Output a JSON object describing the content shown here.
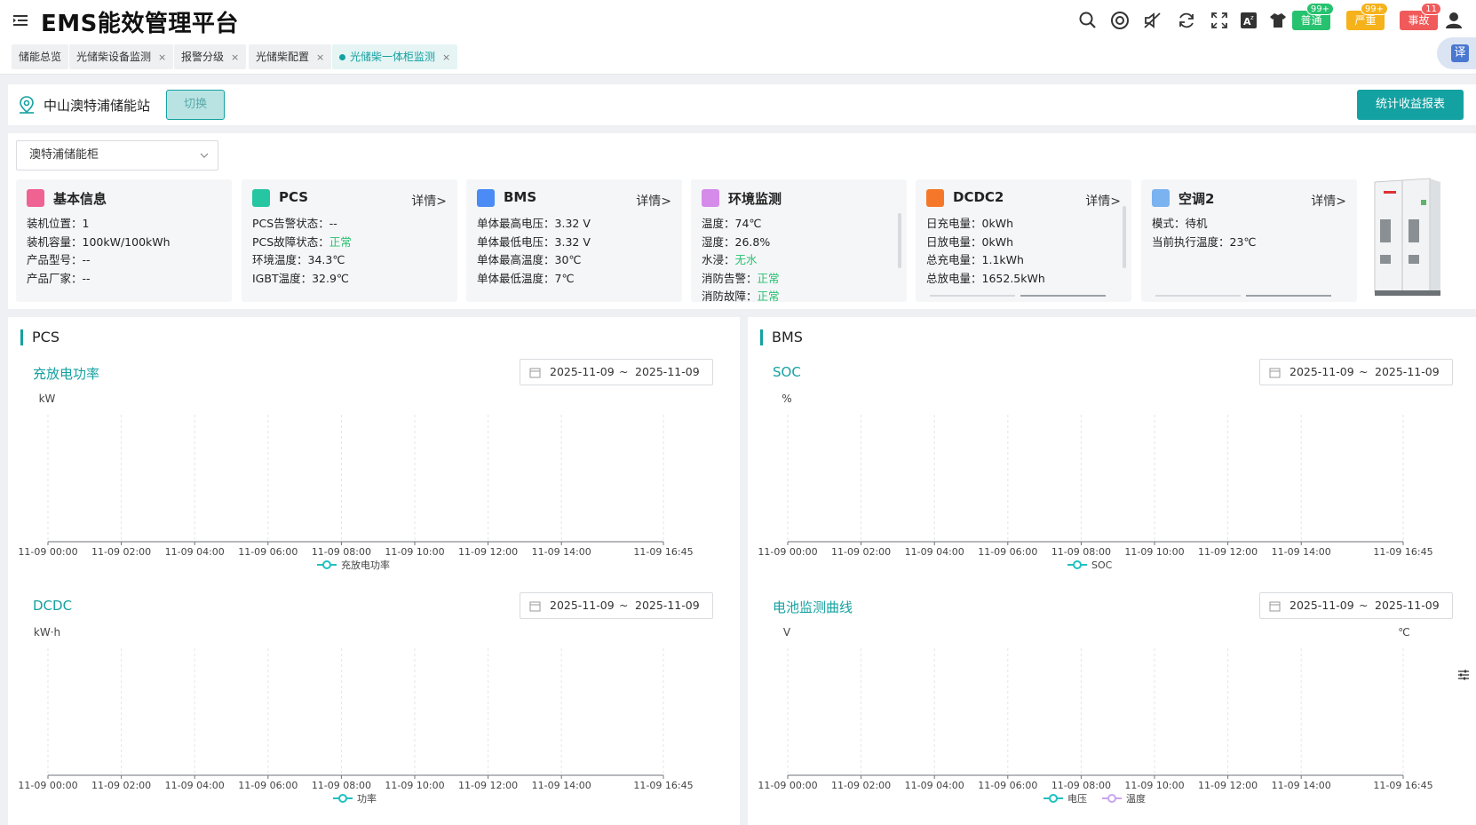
{
  "header": {
    "title": "EMS能效管理平台",
    "alerts": [
      {
        "label": "普通",
        "count": "99+",
        "color": "#27c26f"
      },
      {
        "label": "严重",
        "count": "99+",
        "color": "#f5b21a"
      },
      {
        "label": "事故",
        "count": "11",
        "color": "#f15a5a"
      }
    ]
  },
  "tabs": [
    {
      "label": "储能总览",
      "closable": false
    },
    {
      "label": "光储柴设备监测",
      "closable": true
    },
    {
      "label": "报警分级",
      "closable": true
    },
    {
      "label": "光储柴配置",
      "closable": true
    },
    {
      "label": "光储柴一体柜监测",
      "closable": true,
      "active": true
    }
  ],
  "translate": "译",
  "station": {
    "name": "中山澳特浦储能站",
    "switch_label": "切换",
    "report_label": "统计收益报表"
  },
  "cabinet_select": {
    "value": "澳特浦储能柜"
  },
  "cards": [
    {
      "title": "基本信息",
      "icon": "info-icon",
      "color": "#f06292",
      "detail": "",
      "rows": [
        [
          "装机位置：",
          "1"
        ],
        [
          "装机容量：",
          "100kW/100kWh"
        ],
        [
          "产品型号：",
          "--"
        ],
        [
          "产品厂家：",
          "--"
        ]
      ]
    },
    {
      "title": "PCS",
      "icon": "pcs-icon",
      "color": "#26c6a2",
      "detail": "详情>",
      "rows": [
        [
          "PCS告警状态：",
          "--"
        ],
        [
          "PCS故障状态：",
          "正常"
        ],
        [
          "环境温度：",
          "34.3℃"
        ],
        [
          "IGBT温度：",
          "32.9℃"
        ]
      ]
    },
    {
      "title": "BMS",
      "icon": "bms-icon",
      "color": "#4a8bf5",
      "detail": "详情>",
      "rows": [
        [
          "单体最高电压：",
          "3.32 V"
        ],
        [
          "单体最低电压：",
          "3.32 V"
        ],
        [
          "单体最高温度：",
          "30℃"
        ],
        [
          "单体最低温度：",
          "7℃"
        ]
      ]
    },
    {
      "title": "环境监测",
      "icon": "environment-icon",
      "color": "#d58bea",
      "detail": "",
      "rows": [
        [
          "温度：",
          "74℃"
        ],
        [
          "湿度：",
          "26.8%"
        ],
        [
          "水浸：",
          "无水"
        ],
        [
          "消防告警：",
          "正常"
        ],
        [
          "消防故障：",
          "正常"
        ]
      ]
    },
    {
      "title": "DCDC2",
      "icon": "dcdc-icon",
      "color": "#f5782a",
      "detail": "详情>",
      "rows": [
        [
          "日充电量：",
          "0kWh"
        ],
        [
          "日放电量：",
          "0kWh"
        ],
        [
          "总充电量：",
          "1.1kWh"
        ],
        [
          "总放电量：",
          "1652.5kWh"
        ]
      ]
    },
    {
      "title": "空调2",
      "icon": "aircon-icon",
      "color": "#7ab3f0",
      "detail": "详情>",
      "rows": [
        [
          "模式：",
          "待机"
        ],
        [
          "当前执行温度：",
          "23℃"
        ]
      ]
    }
  ],
  "panels": [
    {
      "title": "PCS",
      "charts": [
        {
          "title": "充放电功率",
          "date_from": "2025-11-09",
          "date_sep": "~",
          "date_to": "2025-11-09"
        },
        {
          "title": "DCDC",
          "date_from": "2025-11-09",
          "date_sep": "~",
          "date_to": "2025-11-09"
        }
      ]
    },
    {
      "title": "BMS",
      "charts": [
        {
          "title": "SOC",
          "date_from": "2025-11-09",
          "date_sep": "~",
          "date_to": "2025-11-09"
        },
        {
          "title": "电池监测曲线",
          "date_from": "2025-11-09",
          "date_sep": "~",
          "date_to": "2025-11-09"
        }
      ]
    }
  ],
  "chart_data": [
    {
      "type": "line",
      "unit": "kW",
      "x": [
        "11-09 00:00",
        "11-09 02:00",
        "11-09 04:00",
        "11-09 06:00",
        "11-09 08:00",
        "11-09 10:00",
        "11-09 12:00",
        "11-09 14:00",
        "11-09 16:45"
      ],
      "series": [
        {
          "name": "充放电功率",
          "color": "#20c0c0",
          "values": []
        }
      ]
    },
    {
      "type": "line",
      "unit": "kW·h",
      "x": [
        "11-09 00:00",
        "11-09 02:00",
        "11-09 04:00",
        "11-09 06:00",
        "11-09 08:00",
        "11-09 10:00",
        "11-09 12:00",
        "11-09 14:00",
        "11-09 16:45"
      ],
      "series": [
        {
          "name": "功率",
          "color": "#20c0c0",
          "values": []
        }
      ]
    },
    {
      "type": "line",
      "unit": "%",
      "x": [
        "11-09 00:00",
        "11-09 02:00",
        "11-09 04:00",
        "11-09 06:00",
        "11-09 08:00",
        "11-09 10:00",
        "11-09 12:00",
        "11-09 14:00",
        "11-09 16:45"
      ],
      "series": [
        {
          "name": "SOC",
          "color": "#20c0c0",
          "values": []
        }
      ]
    },
    {
      "type": "line",
      "unit": "V",
      "unit_right": "℃",
      "x": [
        "11-09 00:00",
        "11-09 02:00",
        "11-09 04:00",
        "11-09 06:00",
        "11-09 08:00",
        "11-09 10:00",
        "11-09 12:00",
        "11-09 14:00",
        "11-09 16:45"
      ],
      "series": [
        {
          "name": "电压",
          "color": "#20c0c0",
          "values": []
        },
        {
          "name": "温度",
          "color": "#c9a5f0",
          "values": []
        }
      ]
    }
  ]
}
